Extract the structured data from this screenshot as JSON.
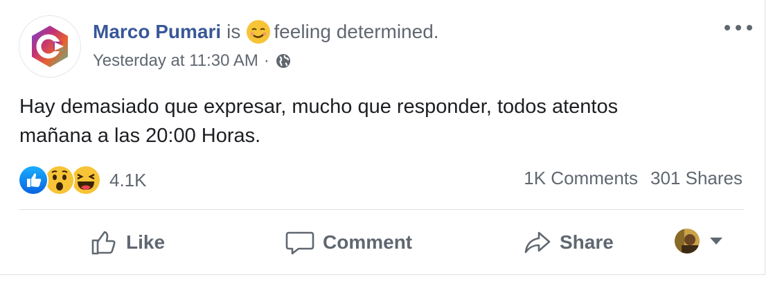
{
  "post": {
    "author": "Marco Pumari",
    "is_text": "is",
    "feeling_text": "feeling determined.",
    "timestamp": "Yesterday at 11:30 AM",
    "separator": "·",
    "body_line1": "Hay demasiado que expresar, mucho que responder, todos atentos",
    "body_line2": "mañana a las 20:00 Horas.",
    "feeling_icon": "smirk-emoji-icon",
    "privacy_icon": "globe-icon"
  },
  "engagement": {
    "reactions": [
      "like",
      "wow",
      "haha"
    ],
    "reaction_count": "4.1K",
    "comments": "1K Comments",
    "shares": "301 Shares"
  },
  "actions": {
    "like_label": "Like",
    "comment_label": "Comment",
    "share_label": "Share"
  },
  "colors": {
    "author_link": "#385898",
    "muted_text": "#606770",
    "like_blue": "#1877f2",
    "emoji_yellow": "#f7c437"
  }
}
